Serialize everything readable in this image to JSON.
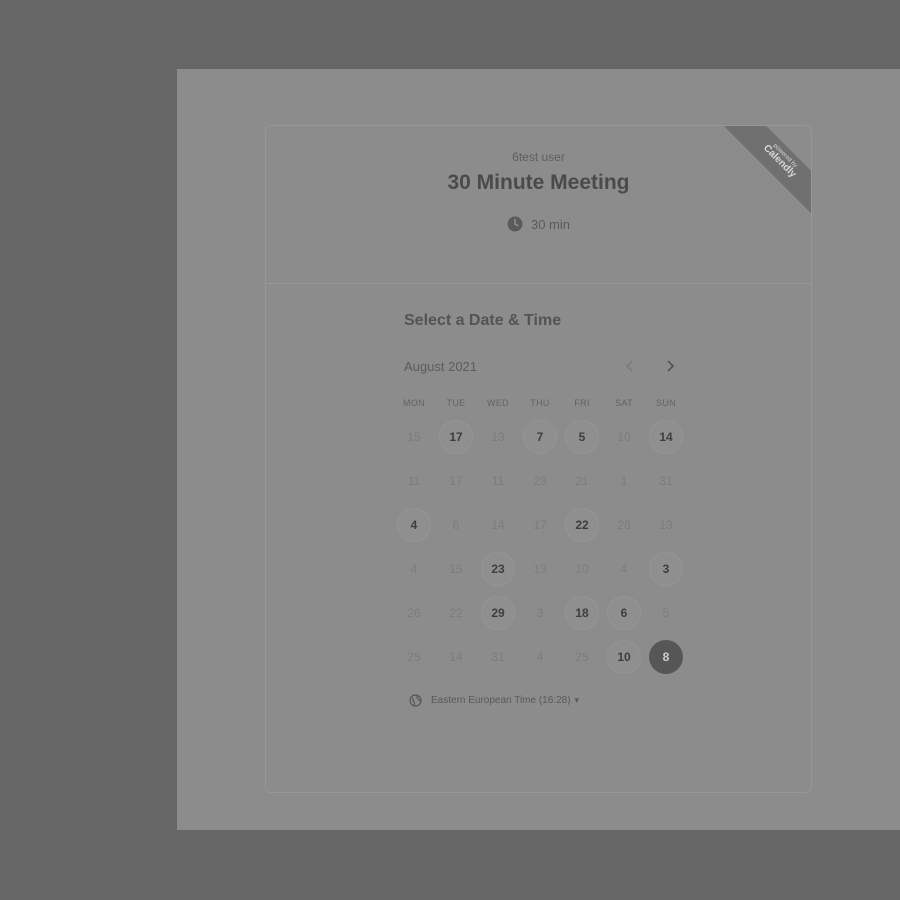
{
  "header": {
    "username": "6test user",
    "event_title": "30 Minute Meeting",
    "duration": "30 min"
  },
  "ribbon": {
    "small_text": "powered by",
    "brand": "Calendly"
  },
  "calendar": {
    "section_title": "Select a Date & Time",
    "month": "August 2021",
    "prev_icon": "chevron-left-icon",
    "next_icon": "chevron-right-icon",
    "weekdays": [
      "MON",
      "TUE",
      "WED",
      "THU",
      "FRI",
      "SAT",
      "SUN"
    ],
    "rows": [
      [
        {
          "d": "15",
          "s": "u"
        },
        {
          "d": "17",
          "s": "a"
        },
        {
          "d": "13",
          "s": "u"
        },
        {
          "d": "7",
          "s": "a"
        },
        {
          "d": "5",
          "s": "a"
        },
        {
          "d": "10",
          "s": "u"
        },
        {
          "d": "14",
          "s": "a"
        }
      ],
      [
        {
          "d": "11",
          "s": "u"
        },
        {
          "d": "17",
          "s": "u"
        },
        {
          "d": "11",
          "s": "u"
        },
        {
          "d": "23",
          "s": "u"
        },
        {
          "d": "21",
          "s": "u"
        },
        {
          "d": "1",
          "s": "u"
        },
        {
          "d": "31",
          "s": "u"
        }
      ],
      [
        {
          "d": "4",
          "s": "a"
        },
        {
          "d": "6",
          "s": "u"
        },
        {
          "d": "14",
          "s": "u"
        },
        {
          "d": "17",
          "s": "u"
        },
        {
          "d": "22",
          "s": "a"
        },
        {
          "d": "28",
          "s": "u"
        },
        {
          "d": "13",
          "s": "u"
        }
      ],
      [
        {
          "d": "4",
          "s": "u"
        },
        {
          "d": "15",
          "s": "u"
        },
        {
          "d": "23",
          "s": "a"
        },
        {
          "d": "13",
          "s": "u"
        },
        {
          "d": "10",
          "s": "u"
        },
        {
          "d": "4",
          "s": "u"
        },
        {
          "d": "3",
          "s": "a"
        }
      ],
      [
        {
          "d": "26",
          "s": "u"
        },
        {
          "d": "22",
          "s": "u"
        },
        {
          "d": "29",
          "s": "a"
        },
        {
          "d": "3",
          "s": "u"
        },
        {
          "d": "18",
          "s": "a"
        },
        {
          "d": "6",
          "s": "a"
        },
        {
          "d": "5",
          "s": "u"
        }
      ],
      [
        {
          "d": "25",
          "s": "u"
        },
        {
          "d": "14",
          "s": "u"
        },
        {
          "d": "31",
          "s": "u"
        },
        {
          "d": "4",
          "s": "u"
        },
        {
          "d": "25",
          "s": "u"
        },
        {
          "d": "10",
          "s": "a"
        },
        {
          "d": "8",
          "s": "sel"
        }
      ]
    ]
  },
  "timezone": {
    "icon": "globe-icon",
    "label": "Eastern European Time (16:28)",
    "caret": "▾"
  },
  "colors": {
    "backdrop": "#666666",
    "frame": "#8c8c8c",
    "selected_day": "#565656"
  }
}
